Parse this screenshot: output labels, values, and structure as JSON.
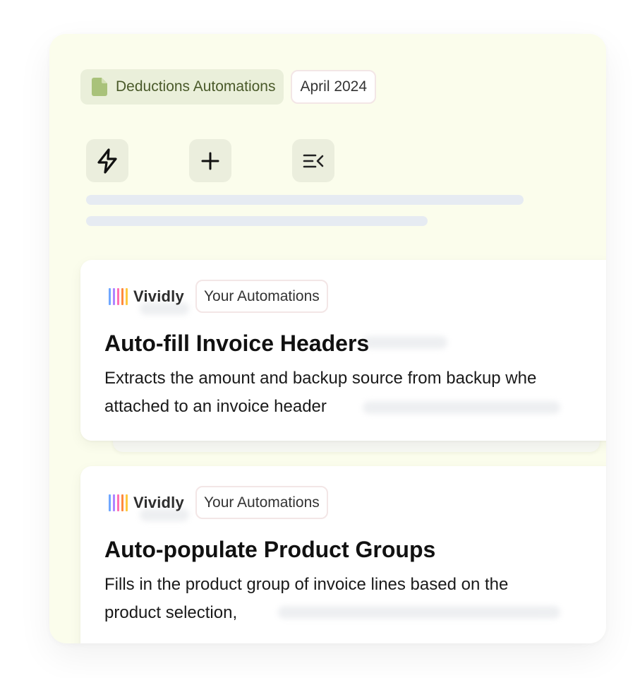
{
  "breadcrumb": {
    "doc_label": "Deductions Automations",
    "date_label": "April 2024"
  },
  "toolbar": [
    {
      "name": "automation-tool",
      "icon": "lightning-icon"
    },
    {
      "name": "add-tool",
      "icon": "plus-icon"
    },
    {
      "name": "collapse-tool",
      "icon": "list-collapse-icon"
    }
  ],
  "cards": [
    {
      "brand": "Vividly",
      "tag": "Your Automations",
      "title": "Auto-fill Invoice Headers",
      "description_line1": "Extracts the amount and backup source from backup whe",
      "description_line2": "attached to an invoice header"
    },
    {
      "brand": "Vividly",
      "tag": "Your Automations",
      "title": "Auto-populate Product Groups",
      "description_line1": "Fills in the product group of invoice lines based on the",
      "description_line2": "product selection,"
    }
  ],
  "colors": {
    "panel_bg": "#fbfdec",
    "doc_chip_bg": "#eaefda",
    "doc_chip_text": "#4a5a2a",
    "doc_icon": "#a9c27a",
    "tool_bg": "#ebeedd",
    "skeleton": "#e6ebf2",
    "logo_bars": [
      "#6fa8ff",
      "#b084ff",
      "#ff6fb5",
      "#ff8a3d",
      "#ffc83d"
    ]
  }
}
